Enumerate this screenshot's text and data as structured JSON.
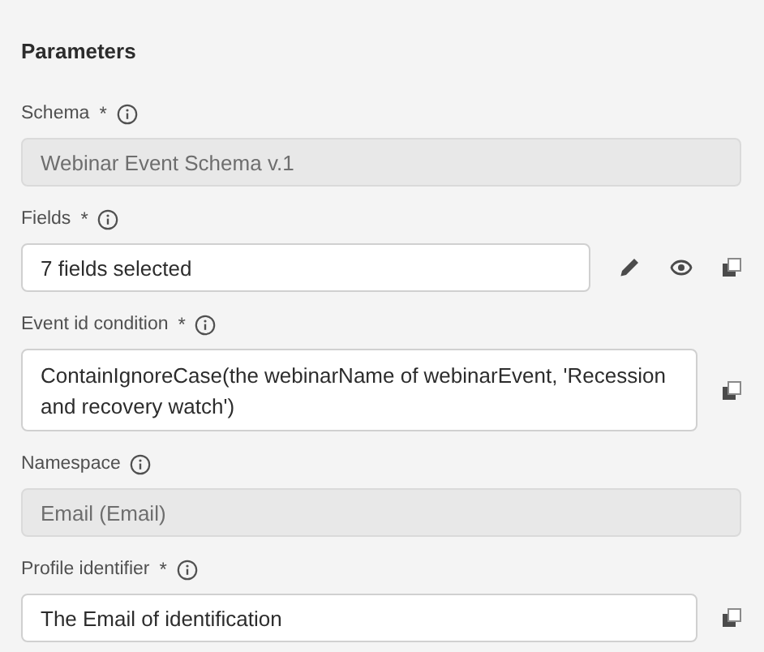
{
  "title": "Parameters",
  "fields": [
    {
      "kind": "input",
      "label": "Schema",
      "required_mark": "*",
      "value": "Webinar Event Schema v.1",
      "disabled": true
    },
    {
      "kind": "input",
      "label": "Fields",
      "required_mark": "*",
      "value": "7 fields selected",
      "disabled": false,
      "actions": [
        {
          "kind": "edit"
        },
        {
          "kind": "preview"
        },
        {
          "kind": "copy"
        }
      ]
    },
    {
      "kind": "textarea",
      "label": "Event id condition",
      "required_mark": "*",
      "value": "ContainIgnoreCase(the webinarName of webinarEvent, 'Recession and recovery watch')",
      "disabled": false,
      "actions": [
        {
          "kind": "copy"
        }
      ]
    },
    {
      "kind": "input",
      "label": "Namespace",
      "value": "Email (Email)",
      "disabled": true
    },
    {
      "kind": "input",
      "label": "Profile identifier",
      "required_mark": "*",
      "value": "The Email of identification",
      "disabled": false,
      "actions": [
        {
          "kind": "copy"
        }
      ]
    }
  ]
}
